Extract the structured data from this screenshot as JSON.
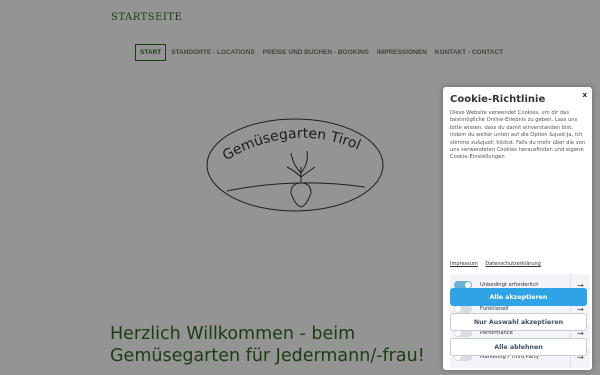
{
  "site": {
    "brand": "STARTSEITE",
    "nav": [
      {
        "label": "START",
        "active": true
      },
      {
        "label": "STANDORTE - LOCATIONS",
        "active": false
      },
      {
        "label": "PREISE UND BUCHEN - BOOKING",
        "active": false
      },
      {
        "label": "IMPRESSIONEN",
        "active": false
      },
      {
        "label": "KONTAKT - CONTACT",
        "active": false
      }
    ],
    "logo_text": "Gemüsegarten Tirol",
    "hero_line1": "Herzlich Willkommen - beim",
    "hero_line2": "Gemüsegarten für Jedermann/-frau!"
  },
  "cookie": {
    "close": "x",
    "title": "Cookie-Richtlinie",
    "text": "Diese Website verwendet Cookies, um dir das bestmögliche Online-Erlebnis zu geben. Lass uns bitte wissen, dass du damit einverstanden bist, indem du weiter unten auf die Option &quot;Ja, ich stimme zu&quot; klickst. Falls du mehr über die von uns verwendeten Cookies herausfinden und eigene Cookie-Einstellungen",
    "link_impressum": "Impressum",
    "link_privacy": "Datenschutzerklärung",
    "categories": [
      {
        "label": "Unbedingt erforderlich",
        "enabled": true
      },
      {
        "label": "Funktionell",
        "enabled": false
      },
      {
        "label": "Performance",
        "enabled": false
      },
      {
        "label": "Marketing / Third Party",
        "enabled": false
      }
    ],
    "arrow_icon": "→",
    "accept_all": "Alle akzeptieren",
    "accept_selection": "Nur Auswahl akzeptieren",
    "reject_all": "Alle ablehnen"
  },
  "colors": {
    "brand_green": "#2d6a1f",
    "accept_blue": "#2fa3e6",
    "toggle_on": "#6ab0d8"
  }
}
